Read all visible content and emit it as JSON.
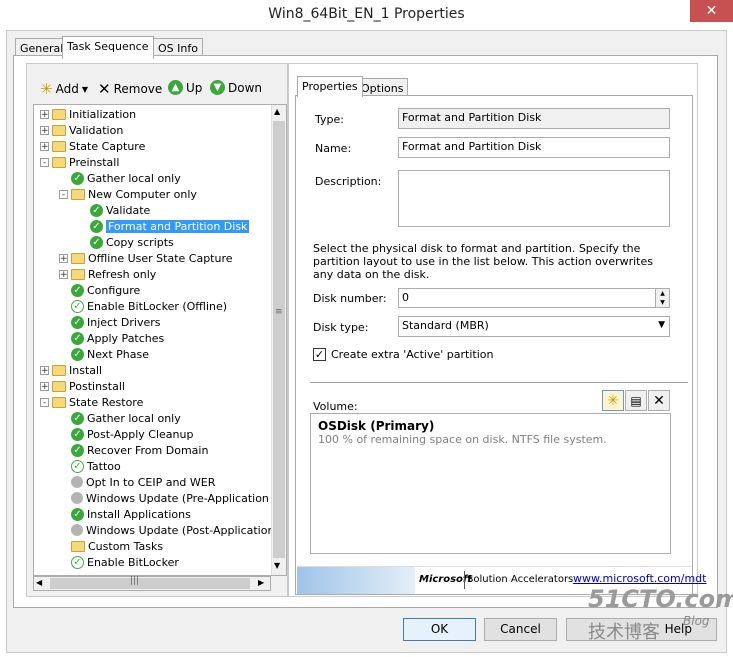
{
  "window": {
    "title": "Win8_64Bit_EN_1 Properties",
    "close": "✕"
  },
  "tabs": [
    "General",
    "Task Sequence",
    "OS Info"
  ],
  "toolbar": {
    "add": "Add",
    "remove": "Remove",
    "up": "Up",
    "down": "Down"
  },
  "tree": [
    {
      "label": "Initialization",
      "level": 0,
      "icon": "folder",
      "expander": "+"
    },
    {
      "label": "Validation",
      "level": 0,
      "icon": "folder",
      "expander": "+"
    },
    {
      "label": "State Capture",
      "level": 0,
      "icon": "folder",
      "expander": "+"
    },
    {
      "label": "Preinstall",
      "level": 0,
      "icon": "folder",
      "expander": "-"
    },
    {
      "label": "Gather local only",
      "level": 1,
      "icon": "check"
    },
    {
      "label": "New Computer only",
      "level": 1,
      "icon": "folder",
      "expander": "-"
    },
    {
      "label": "Validate",
      "level": 2,
      "icon": "check"
    },
    {
      "label": "Format and Partition Disk",
      "level": 2,
      "icon": "check",
      "selected": true
    },
    {
      "label": "Copy scripts",
      "level": 2,
      "icon": "check"
    },
    {
      "label": "Offline User State Capture",
      "level": 1,
      "icon": "folder",
      "expander": "+"
    },
    {
      "label": "Refresh only",
      "level": 1,
      "icon": "folder",
      "expander": "+"
    },
    {
      "label": "Configure",
      "level": 1,
      "icon": "check"
    },
    {
      "label": "Enable BitLocker (Offline)",
      "level": 1,
      "icon": "check-white"
    },
    {
      "label": "Inject Drivers",
      "level": 1,
      "icon": "check"
    },
    {
      "label": "Apply Patches",
      "level": 1,
      "icon": "check"
    },
    {
      "label": "Next Phase",
      "level": 1,
      "icon": "check"
    },
    {
      "label": "Install",
      "level": 0,
      "icon": "folder",
      "expander": "+"
    },
    {
      "label": "Postinstall",
      "level": 0,
      "icon": "folder",
      "expander": "+"
    },
    {
      "label": "State Restore",
      "level": 0,
      "icon": "folder",
      "expander": "-"
    },
    {
      "label": "Gather local only",
      "level": 1,
      "icon": "check"
    },
    {
      "label": "Post-Apply Cleanup",
      "level": 1,
      "icon": "check"
    },
    {
      "label": "Recover From Domain",
      "level": 1,
      "icon": "check"
    },
    {
      "label": "Tattoo",
      "level": 1,
      "icon": "check-white"
    },
    {
      "label": "Opt In to CEIP and WER",
      "level": 1,
      "icon": "gray"
    },
    {
      "label": "Windows Update (Pre-Application Inst",
      "level": 1,
      "icon": "gray"
    },
    {
      "label": "Install Applications",
      "level": 1,
      "icon": "check"
    },
    {
      "label": "Windows Update (Post-Application Ins",
      "level": 1,
      "icon": "gray"
    },
    {
      "label": "Custom Tasks",
      "level": 1,
      "icon": "folder"
    },
    {
      "label": "Enable BitLocker",
      "level": 1,
      "icon": "check-white"
    }
  ],
  "right_tabs": [
    "Properties",
    "Options"
  ],
  "props": {
    "type_label": "Type:",
    "type_value": "Format and Partition Disk",
    "name_label": "Name:",
    "name_value": "Format and Partition Disk",
    "description_label": "Description:",
    "description_value": "",
    "info": "Select the physical disk to format and partition.  Specify the partition layout to use in the list below. This action overwrites any data on the disk.",
    "disk_number_label": "Disk number:",
    "disk_number_value": "0",
    "disk_type_label": "Disk type:",
    "disk_type_value": "Standard (MBR)",
    "extra_active_label": "Create extra 'Active' partition",
    "extra_active_checked": true,
    "volume_label": "Volume:",
    "volume_title": "OSDisk (Primary)",
    "volume_desc": "100 % of remaining space on disk. NTFS file system."
  },
  "footer": {
    "microsoft": "Microsoft",
    "solution": "Solution Accelerators",
    "link": "www.microsoft.com/mdt"
  },
  "buttons": {
    "ok": "OK",
    "cancel": "Cancel",
    "help": "Help"
  },
  "watermark": {
    "site": "51CTO.com",
    "text": "技术博客",
    "blog": "Blog"
  }
}
